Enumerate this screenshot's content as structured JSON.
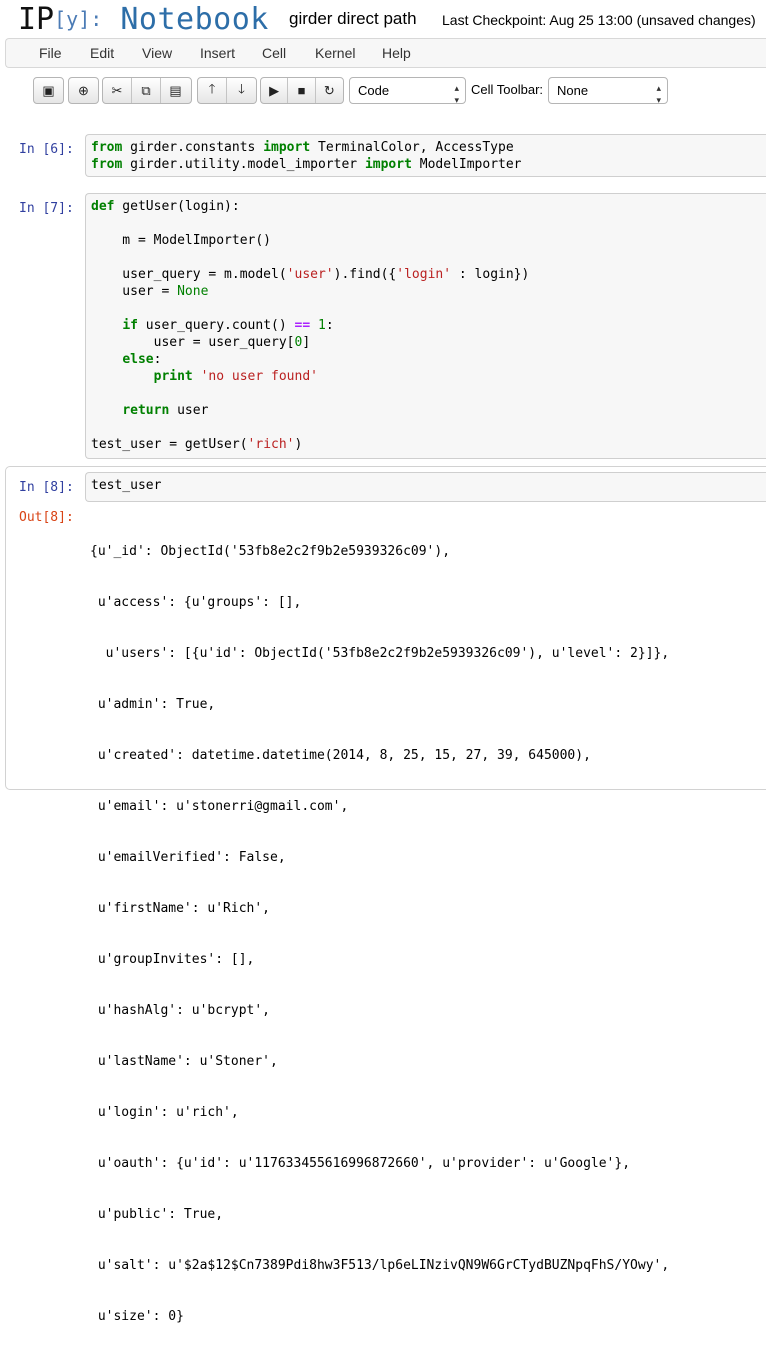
{
  "header": {
    "logo_prefix": "IP",
    "logo_bracket": "[y]:",
    "logo_word": "Notebook",
    "notebook_name": "girder direct path",
    "checkpoint": "Last Checkpoint: Aug 25 13:00 (unsaved changes)"
  },
  "menubar": {
    "items": [
      "File",
      "Edit",
      "View",
      "Insert",
      "Cell",
      "Kernel",
      "Help"
    ]
  },
  "toolbar": {
    "buttons": [
      {
        "name": "save-button",
        "icon": "floppy-icon",
        "glyph": "▣"
      },
      {
        "name": "insert-cell-button",
        "icon": "plus-circle-icon",
        "glyph": "⊕"
      },
      {
        "name": "cut-button",
        "icon": "scissors-icon",
        "glyph": "✂"
      },
      {
        "name": "copy-button",
        "icon": "copy-icon",
        "glyph": "⧉"
      },
      {
        "name": "paste-button",
        "icon": "clipboard-icon",
        "glyph": "▤"
      },
      {
        "name": "move-up-button",
        "icon": "arrow-up-icon",
        "glyph": "🡑"
      },
      {
        "name": "move-down-button",
        "icon": "arrow-down-icon",
        "glyph": "🡓"
      },
      {
        "name": "run-button",
        "icon": "play-icon",
        "glyph": "▶"
      },
      {
        "name": "interrupt-button",
        "icon": "stop-icon",
        "glyph": "■"
      },
      {
        "name": "restart-button",
        "icon": "refresh-icon",
        "glyph": "↻"
      }
    ],
    "cell_type_value": "Code",
    "cell_toolbar_label": "Cell Toolbar:",
    "cell_toolbar_value": "None"
  },
  "cells": {
    "c6": {
      "prompt": "In [6]:",
      "lines": [
        "from girder.constants import TerminalColor, AccessType",
        "from girder.utility.model_importer import ModelImporter"
      ]
    },
    "c7": {
      "prompt": "In [7]:",
      "lines": [
        "def getUser(login):",
        "",
        "    m = ModelImporter()",
        "",
        "    user_query = m.model('user').find({'login' : login})",
        "    user = None",
        "",
        "    if user_query.count() == 1:",
        "        user = user_query[0]",
        "    else:",
        "        print 'no user found'",
        "",
        "    return user",
        "",
        "test_user = getUser('rich')"
      ]
    },
    "c8": {
      "prompt": "In [8]:",
      "code": "test_user",
      "out_prompt": "Out[8]:",
      "output": [
        "{u'_id': ObjectId('53fb8e2c2f9b2e5939326c09'),",
        " u'access': {u'groups': [],",
        "  u'users': [{u'id': ObjectId('53fb8e2c2f9b2e5939326c09'), u'level': 2}]},",
        " u'admin': True,",
        " u'created': datetime.datetime(2014, 8, 25, 15, 27, 39, 645000),",
        " u'email': u'stonerri@gmail.com',",
        " u'emailVerified': False,",
        " u'firstName': u'Rich',",
        " u'groupInvites': [],",
        " u'hashAlg': u'bcrypt',",
        " u'lastName': u'Stoner',",
        " u'login': u'rich',",
        " u'oauth': {u'id': u'117633455616996872660', u'provider': u'Google'},",
        " u'public': True,",
        " u'salt': u'$2a$12$Cn7389Pdi8hw3F513/lp6eLINzivQN9W6GrCTydBUZNpqFhS/YOwy',",
        " u'size': 0}"
      ]
    }
  }
}
